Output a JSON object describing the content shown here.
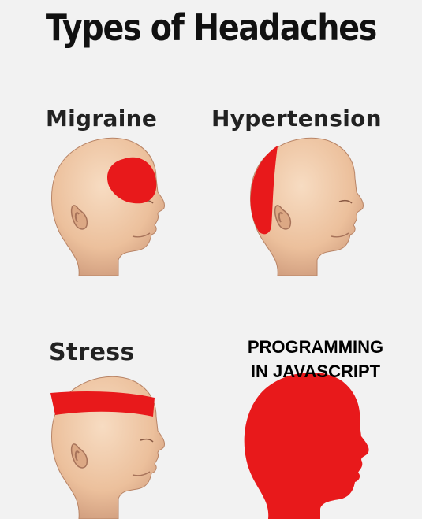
{
  "title": "Types of Headaches",
  "panels": [
    {
      "label": "Migraine"
    },
    {
      "label": "Hypertension"
    },
    {
      "label": "Stress"
    },
    {
      "label_line1": "PROGRAMMING",
      "label_line2": "IN JAVASCRIPT"
    }
  ],
  "colors": {
    "pain": "#e8191b",
    "skin": "#f0c9a6",
    "background": "#f2f2f2"
  }
}
